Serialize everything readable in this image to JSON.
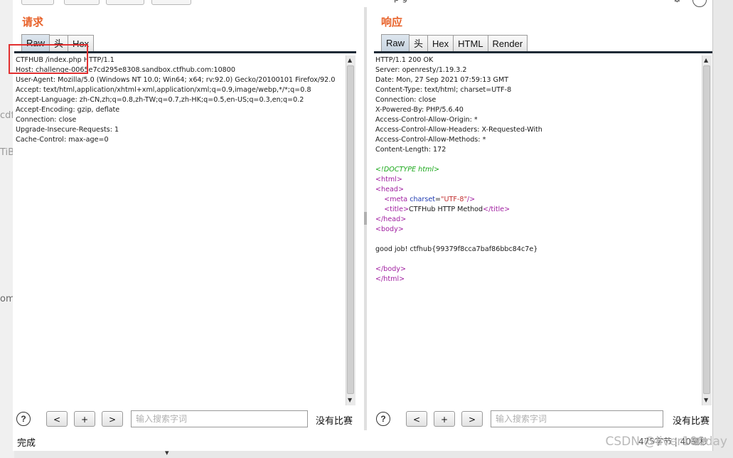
{
  "background": {
    "fragments": [
      "cdf",
      "TiB",
      "om:"
    ]
  },
  "window": {
    "request_title": "请求",
    "response_title": "响应",
    "request_tabs": [
      "Raw",
      "头",
      "Hex"
    ],
    "response_tabs": [
      "Raw",
      "头",
      "Hex",
      "HTML",
      "Render"
    ],
    "active_tab": "Raw",
    "top_partial_text": "p     g"
  },
  "request": {
    "lines": [
      "CTFHUB /index.php HTTP/1.1",
      "Host: challenge-0065e7cd295e8308.sandbox.ctfhub.com:10800",
      "User-Agent: Mozilla/5.0 (Windows NT 10.0; Win64; x64; rv:92.0) Gecko/20100101 Firefox/92.0",
      "Accept: text/html,application/xhtml+xml,application/xml;q=0.9,image/webp,*/*;q=0.8",
      "Accept-Language: zh-CN,zh;q=0.8,zh-TW;q=0.7,zh-HK;q=0.5,en-US;q=0.3,en;q=0.2",
      "Accept-Encoding: gzip, deflate",
      "Connection: close",
      "Upgrade-Insecure-Requests: 1",
      "Cache-Control: max-age=0"
    ]
  },
  "response": {
    "header_lines": [
      "HTTP/1.1 200 OK",
      "Server: openresty/1.19.3.2",
      "Date: Mon, 27 Sep 2021 07:59:13 GMT",
      "Content-Type: text/html; charset=UTF-8",
      "Connection: close",
      "X-Powered-By: PHP/5.6.40",
      "Access-Control-Allow-Origin: *",
      "Access-Control-Allow-Headers: X-Requested-With",
      "Access-Control-Allow-Methods: *",
      "Content-Length: 172"
    ],
    "doctype": "<!DOCTYPE html>",
    "html_open": "<html>",
    "head_open": "<head>",
    "meta_tag_open": "<meta",
    "meta_attr": "charset",
    "meta_eq": "=",
    "meta_val": "\"UTF-8\"",
    "meta_close": "/>",
    "title_open": "<title>",
    "title_text": "CTFHub HTTP Method",
    "title_close": "</title>",
    "head_close": "</head>",
    "body_open": "<body>",
    "body_text": "good job! ctfhub{99379f8cca7baf86bbc84c7e}",
    "body_close": "</body>",
    "html_close": "</html>"
  },
  "bottom": {
    "help": "?",
    "prev": "<",
    "add": "+",
    "next": ">",
    "search_placeholder": "输入搜索字词",
    "no_match": "没有比赛"
  },
  "status": {
    "done": "完成",
    "bytes_info": "475字节 | 40毫秒"
  },
  "watermark": "CSDN @liver100day"
}
